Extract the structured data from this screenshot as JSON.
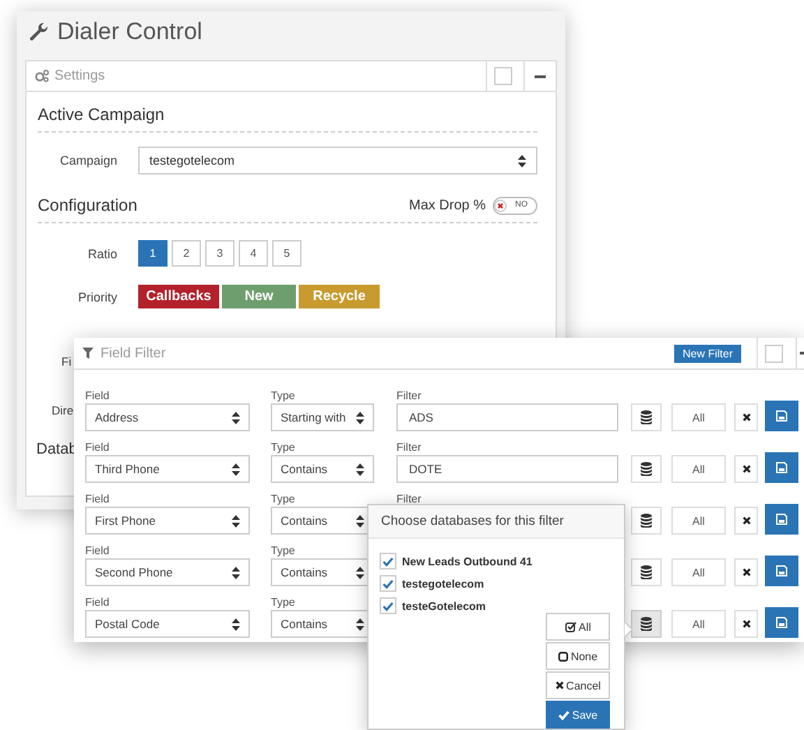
{
  "window": {
    "title": "Dialer Control"
  },
  "settings_panel": {
    "title": "Settings",
    "active_campaign": {
      "heading": "Active Campaign",
      "campaign_label": "Campaign",
      "campaign_value": "testegotelecom"
    },
    "configuration": {
      "heading": "Configuration",
      "max_drop_label": "Max Drop %",
      "max_drop_toggle": {
        "on": false,
        "label": "NO"
      },
      "ratio_label": "Ratio",
      "ratio_options": [
        {
          "label": "1",
          "selected": true
        },
        {
          "label": "2",
          "selected": false
        },
        {
          "label": "3",
          "selected": false
        },
        {
          "label": "4",
          "selected": false
        },
        {
          "label": "5",
          "selected": false
        }
      ],
      "priority_label": "Priority",
      "priorities": [
        {
          "label": "Callbacks",
          "color": "#b3212b"
        },
        {
          "label": "New",
          "color": "#6e9e6e"
        },
        {
          "label": "Recycle",
          "color": "#c99a2e"
        }
      ]
    },
    "obscured_labels": [
      "Fi",
      "Dire"
    ],
    "obscured_heading": "Datab"
  },
  "field_filter": {
    "title": "Field Filter",
    "new_filter_button": "New Filter",
    "rows": [
      {
        "field_label": "Field",
        "field": "Address",
        "type_label": "Type",
        "type": "Starting with",
        "filter_label": "Filter",
        "filter": "ADS",
        "databases": "All",
        "database_active": false
      },
      {
        "field_label": "Field",
        "field": "Third Phone",
        "type_label": "Type",
        "type": "Contains",
        "filter_label": "Filter",
        "filter": "DOTE",
        "databases": "All",
        "database_active": false
      },
      {
        "field_label": "Field",
        "field": "First Phone",
        "type_label": "Type",
        "type": "Contains",
        "filter_label": "Filter",
        "databases": "All",
        "database_active": false
      },
      {
        "field_label": "Field",
        "field": "Second Phone",
        "type_label": "Type",
        "type": "Contains",
        "databases": "All",
        "database_active": false
      },
      {
        "field_label": "Field",
        "field": "Postal Code",
        "type_label": "Type",
        "type": "Contains",
        "databases": "All",
        "database_active": true
      }
    ]
  },
  "database_popover": {
    "title": "Choose databases for this filter",
    "databases": [
      {
        "name": "New Leads Outbound 41",
        "checked": true
      },
      {
        "name": "testegotelecom",
        "checked": true
      },
      {
        "name": "testeGotelecom",
        "checked": true
      }
    ],
    "buttons": [
      {
        "kind": "all",
        "label": "All"
      },
      {
        "kind": "none",
        "label": "None"
      },
      {
        "kind": "cancel",
        "label": "Cancel"
      },
      {
        "kind": "save",
        "label": "Save"
      }
    ]
  }
}
